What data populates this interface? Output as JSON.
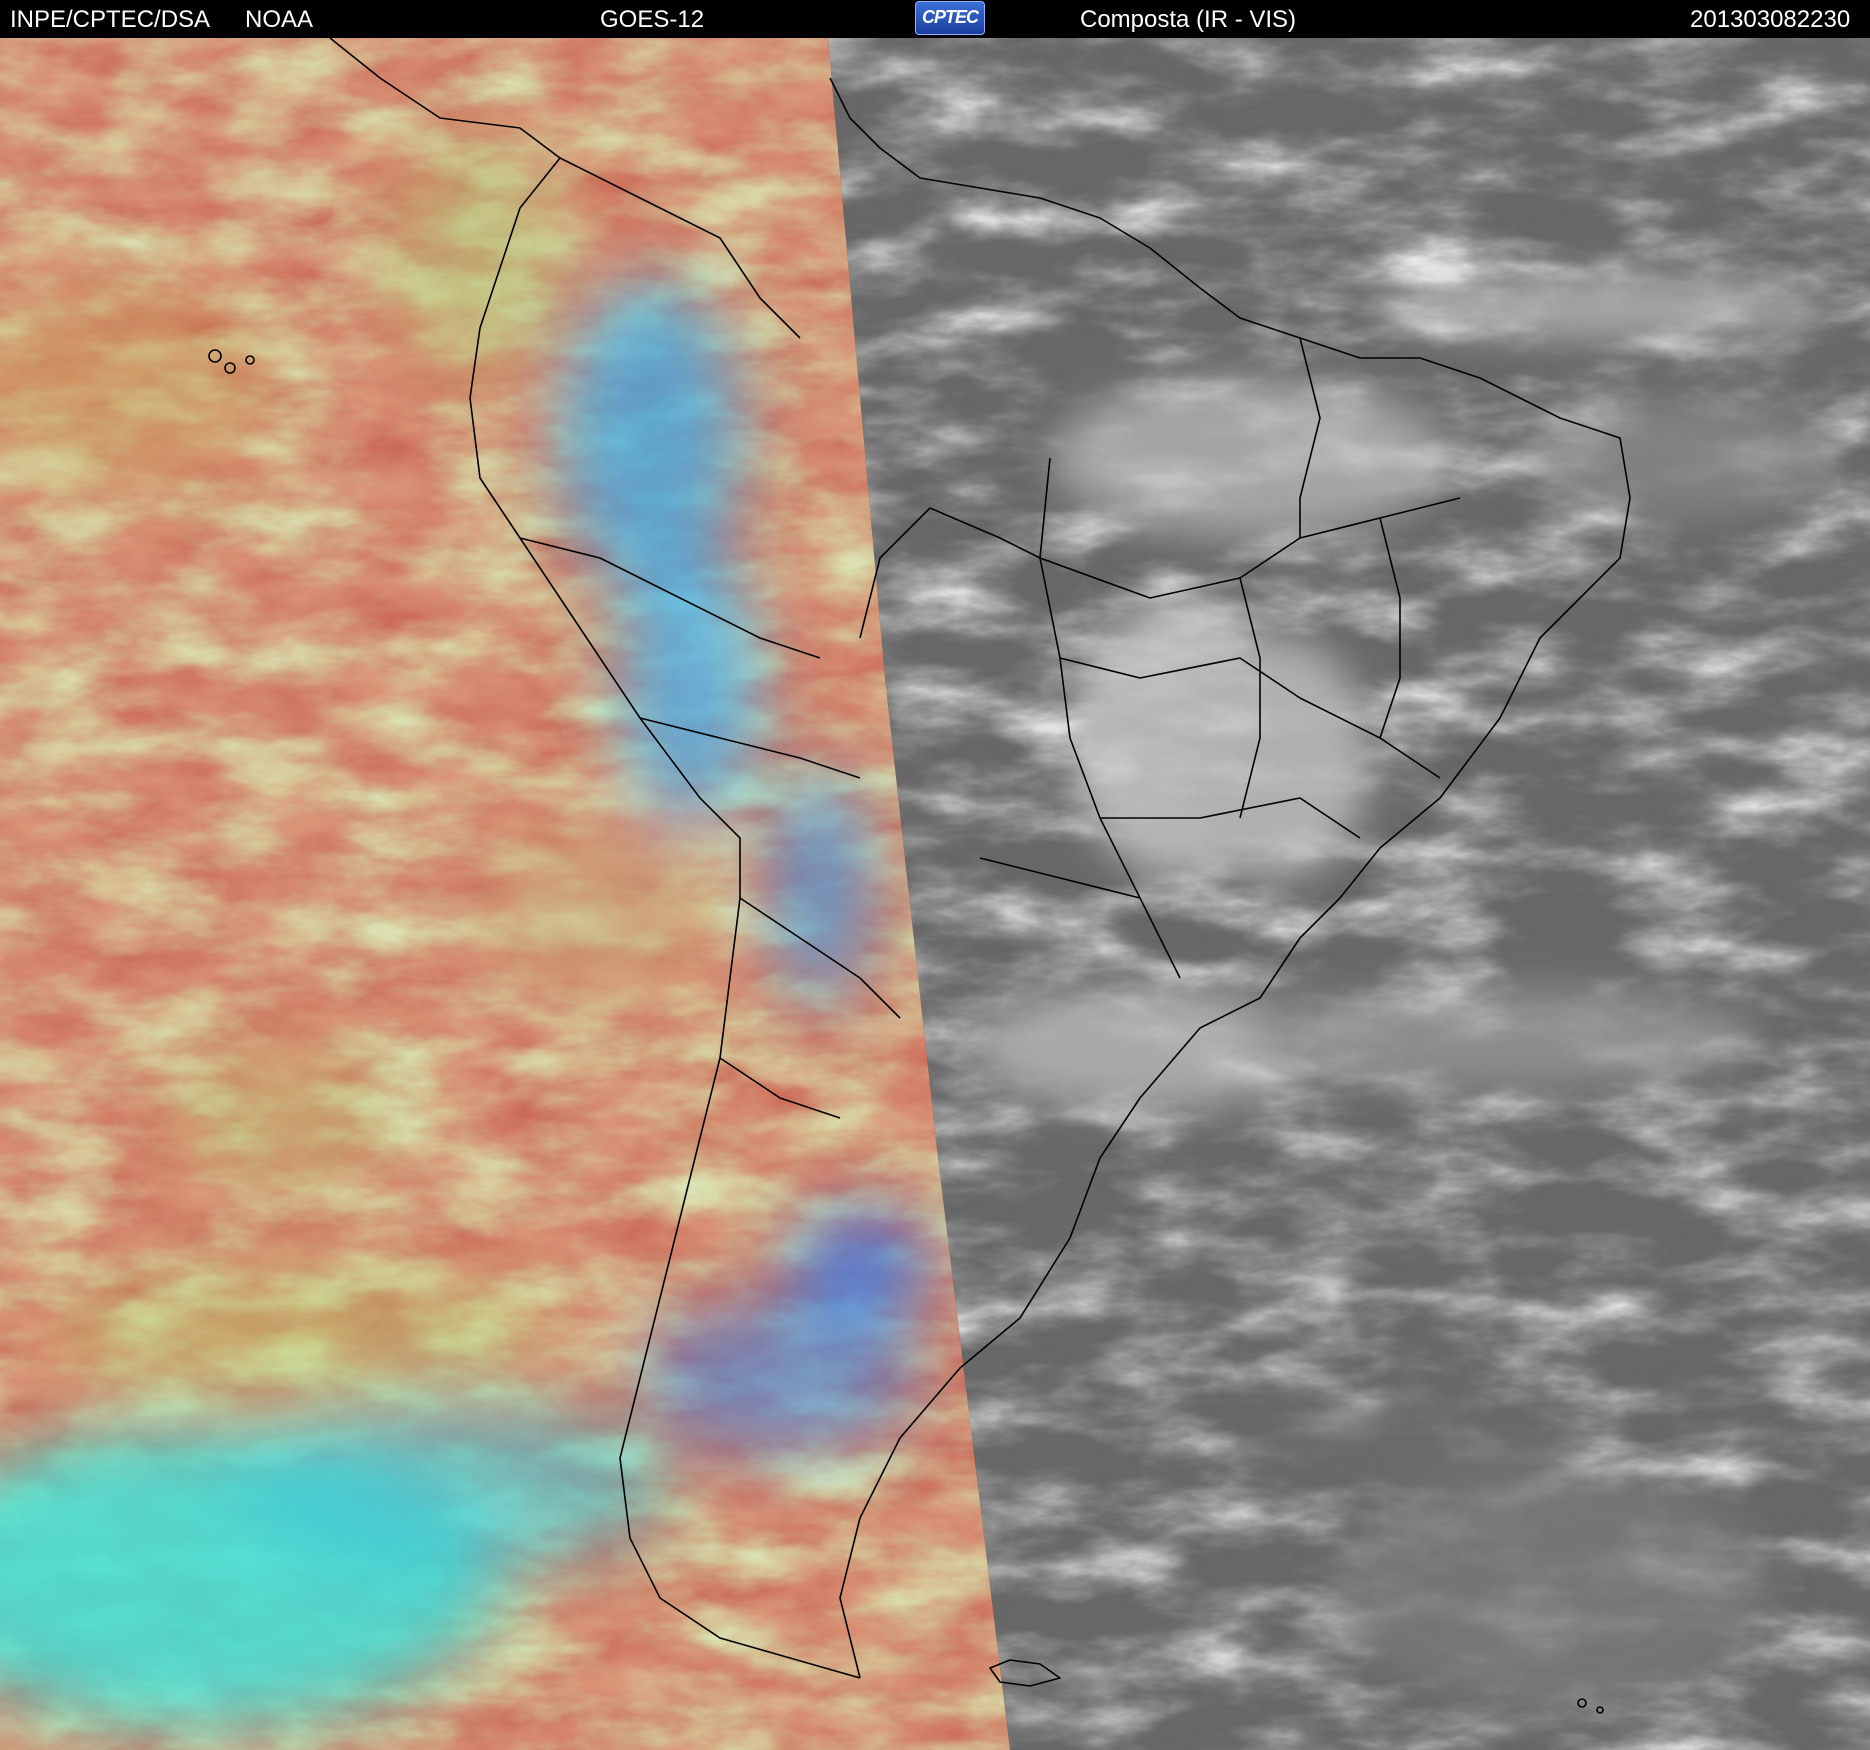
{
  "header": {
    "agency": "INPE/CPTEC/DSA",
    "partner": "NOAA",
    "satellite": "GOES-12",
    "logo_text": "CPTEC",
    "product": "Composta (IR - VIS)",
    "timestamp": "201303082230"
  },
  "colors": {
    "ir_red": "#c04a3a",
    "ir_orange": "#d0603a",
    "ir_yellow_green": "#b8c060",
    "ir_cyan": "#40d8d8",
    "ir_blue": "#3a8ae8",
    "vis_dark": "#2a2a2a",
    "vis_cloud": "#c8c8c8",
    "coastline": "#000000"
  },
  "icons": {
    "logo": "cptec-logo"
  }
}
